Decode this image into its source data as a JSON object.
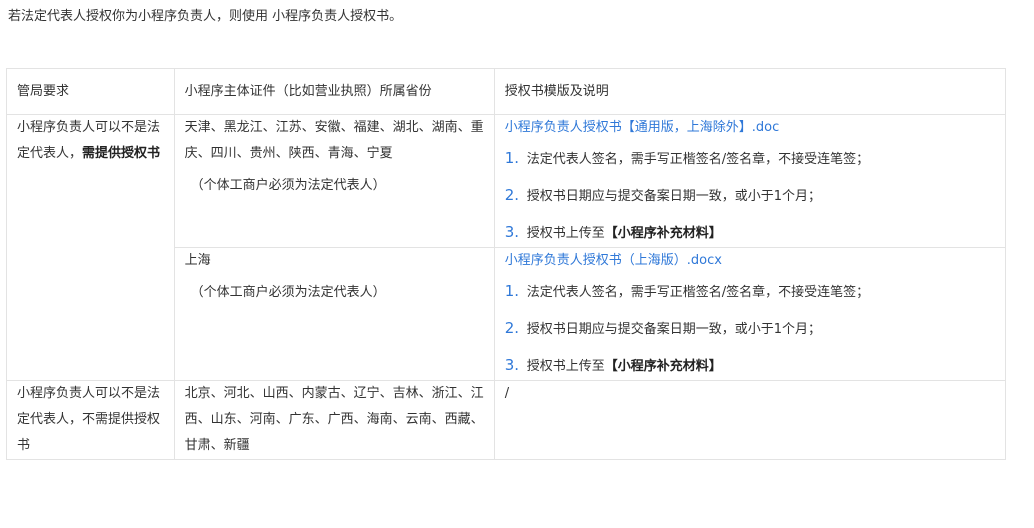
{
  "intro": "若法定代表人授权你为小程序负责人，则使用 小程序负责人授权书。",
  "headers": [
    "管局要求",
    "小程序主体证件（比如营业执照）所属省份",
    "授权书模版及说明"
  ],
  "row1": {
    "req_prefix": "小程序负责人可以不是法定代表人，",
    "req_bold": "需提供授权书",
    "provinces": "天津、黑龙江、江苏、安徽、福建、湖北、湖南、重庆、四川、贵州、陕西、青海、宁夏",
    "note": "（个体工商户必须为法定代表人）",
    "link": "小程序负责人授权书【通用版，上海除外】.doc",
    "steps": [
      {
        "num": "1.",
        "text": "法定代表人签名，需手写正楷签名/签名章，不接受连笔签；"
      },
      {
        "num": "2.",
        "text": "授权书日期应与提交备案日期一致，或小于1个月；"
      },
      {
        "num": "3.",
        "text_prefix": "授权书上传至",
        "text_bold": "【小程序补充材料】"
      }
    ]
  },
  "row2": {
    "provinces": "上海",
    "note": "（个体工商户必须为法定代表人）",
    "link": "小程序负责人授权书（上海版）.docx",
    "steps": [
      {
        "num": "1.",
        "text": "法定代表人签名，需手写正楷签名/签名章，不接受连笔签；"
      },
      {
        "num": "2.",
        "text": "授权书日期应与提交备案日期一致，或小于1个月；"
      },
      {
        "num": "3.",
        "text_prefix": "授权书上传至",
        "text_bold": "【小程序补充材料】"
      }
    ]
  },
  "row3": {
    "req": "小程序负责人可以不是法定代表人，不需提供授权书",
    "provinces": "北京、河北、山西、内蒙古、辽宁、吉林、浙江、江西、山东、河南、广东、广西、海南、云南、西藏、甘肃、新疆",
    "template": "/"
  }
}
